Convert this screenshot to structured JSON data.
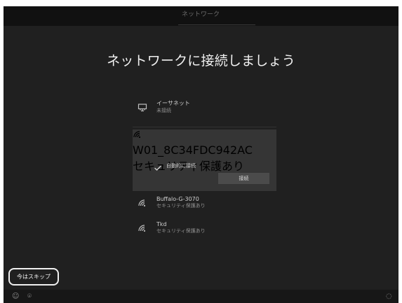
{
  "top": {
    "tab_label": "ネットワーク"
  },
  "page": {
    "title": "ネットワークに接続しましょう"
  },
  "networks": {
    "ethernet": {
      "name": "イーサネット",
      "status": "未接続",
      "icon": "ethernet-icon"
    },
    "selected": {
      "name": "W01_8C34FDC942AC",
      "status": "セキュリティ保護あり",
      "auto_connect_label": "自動的に接続",
      "auto_connect_checked": true,
      "connect_label": "接続",
      "icon": "wifi-icon"
    },
    "others": [
      {
        "name": "Buffalo-G-3070",
        "status": "セキュリティ保護あり",
        "icon": "wifi-icon"
      },
      {
        "name": "Tkd",
        "status": "セキュリティ保護あり",
        "icon": "wifi-icon"
      }
    ]
  },
  "footer": {
    "skip_label": "今はスキップ",
    "left_icon": "accessibility-icon",
    "middle_icon": "microphone-icon",
    "right_icon": "volume-icon"
  },
  "colors": {
    "background": "#202020",
    "header": "#111111",
    "selected_row": "#353535",
    "button": "#4b4b4b",
    "text": "#f1f1f1",
    "muted_text": "#8f8f8f",
    "outline": "#f0f0f0"
  }
}
